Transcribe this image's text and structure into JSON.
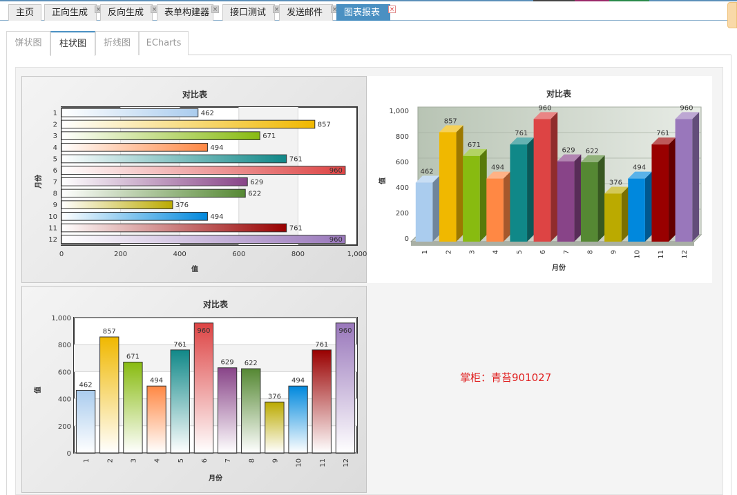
{
  "top_tabs": [
    {
      "label": "主页",
      "closable": false,
      "active": false
    },
    {
      "label": "正向生成",
      "closable": true,
      "active": false
    },
    {
      "label": "反向生成",
      "closable": true,
      "active": false
    },
    {
      "label": "表单构建器",
      "closable": true,
      "active": false
    },
    {
      "label": "接口测试",
      "closable": true,
      "active": false
    },
    {
      "label": "发送邮件",
      "closable": true,
      "active": false
    },
    {
      "label": "图表报表",
      "closable": true,
      "active": true
    }
  ],
  "close_glyph": "×",
  "sub_tabs": [
    {
      "label": "饼状图",
      "active": false
    },
    {
      "label": "柱状图",
      "active": true
    },
    {
      "label": "折线图",
      "active": false
    },
    {
      "label": "ECharts",
      "active": false
    }
  ],
  "signature": "掌柜：青苔901027",
  "colors": {
    "accent": "#4a90c2",
    "signature": "#e02020",
    "series": [
      "#aaccee",
      "#f0b800",
      "#88bb10",
      "#ff8844",
      "#108888",
      "#dd4444",
      "#884488",
      "#558833",
      "#bbaa00",
      "#0088dd",
      "#990000",
      "#9977bb"
    ]
  },
  "chart_data": [
    {
      "type": "bar",
      "orientation": "horizontal",
      "title": "对比表",
      "xlabel": "值",
      "ylabel": "月份",
      "categories": [
        "1",
        "2",
        "3",
        "4",
        "5",
        "6",
        "7",
        "8",
        "9",
        "10",
        "11",
        "12"
      ],
      "values": [
        462,
        857,
        671,
        494,
        761,
        960,
        629,
        622,
        376,
        494,
        761,
        960
      ],
      "value_ticks": [
        "0",
        "200",
        "400",
        "600",
        "800",
        "1,000"
      ],
      "vlim": [
        0,
        1000
      ]
    },
    {
      "type": "bar",
      "style": "3d",
      "title": "对比表",
      "xlabel": "月份",
      "ylabel": "值",
      "categories": [
        "1",
        "2",
        "3",
        "4",
        "5",
        "6",
        "7",
        "8",
        "9",
        "10",
        "11",
        "12"
      ],
      "values": [
        462,
        857,
        671,
        494,
        761,
        960,
        629,
        622,
        376,
        494,
        761,
        960
      ],
      "value_ticks": [
        "0",
        "200",
        "400",
        "600",
        "800",
        "1,000"
      ],
      "vlim": [
        0,
        1000
      ]
    },
    {
      "type": "bar",
      "title": "对比表",
      "xlabel": "月份",
      "ylabel": "值",
      "categories": [
        "1",
        "2",
        "3",
        "4",
        "5",
        "6",
        "7",
        "8",
        "9",
        "10",
        "11",
        "12"
      ],
      "values": [
        462,
        857,
        671,
        494,
        761,
        960,
        629,
        622,
        376,
        494,
        761,
        960
      ],
      "value_ticks": [
        "0",
        "200",
        "400",
        "600",
        "800",
        "1,000"
      ],
      "vlim": [
        0,
        1000
      ]
    }
  ]
}
